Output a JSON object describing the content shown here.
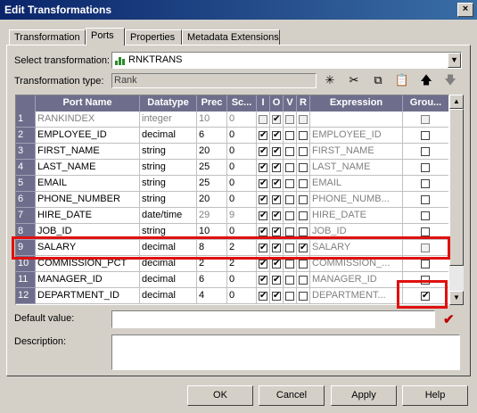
{
  "window": {
    "title": "Edit Transformations",
    "close_glyph": "×"
  },
  "tabs": [
    "Transformation",
    "Ports",
    "Properties",
    "Metadata Extensions"
  ],
  "select_transformation": {
    "label": "Select transformation:",
    "value": "RNKTRANS",
    "icon": "rank-transformation-icon"
  },
  "transformation_type": {
    "label": "Transformation type:",
    "value": "Rank"
  },
  "toolbar": {
    "new_icon": "✳",
    "cut_icon": "✂",
    "copy_icon": "⧉",
    "paste_icon": "📋",
    "up_icon": "🡅",
    "down_icon": "🡇"
  },
  "columns": [
    "Port Name",
    "Datatype",
    "Prec",
    "Sc...",
    "I",
    "O",
    "V",
    "R",
    "Expression",
    "Grou..."
  ],
  "rows": [
    {
      "n": "1",
      "name": "RANKINDEX",
      "type": "integer",
      "prec": "10",
      "scale": "0",
      "I": false,
      "O": true,
      "V": false,
      "R": false,
      "expr": "",
      "group": false,
      "dim": true
    },
    {
      "n": "2",
      "name": "EMPLOYEE_ID",
      "type": "decimal",
      "prec": "6",
      "scale": "0",
      "I": true,
      "O": true,
      "V": false,
      "R": false,
      "expr": "EMPLOYEE_ID",
      "group": false
    },
    {
      "n": "3",
      "name": "FIRST_NAME",
      "type": "string",
      "prec": "20",
      "scale": "0",
      "I": true,
      "O": true,
      "V": false,
      "R": false,
      "expr": "FIRST_NAME",
      "group": false
    },
    {
      "n": "4",
      "name": "LAST_NAME",
      "type": "string",
      "prec": "25",
      "scale": "0",
      "I": true,
      "O": true,
      "V": false,
      "R": false,
      "expr": "LAST_NAME",
      "group": false
    },
    {
      "n": "5",
      "name": "EMAIL",
      "type": "string",
      "prec": "25",
      "scale": "0",
      "I": true,
      "O": true,
      "V": false,
      "R": false,
      "expr": "EMAIL",
      "group": false
    },
    {
      "n": "6",
      "name": "PHONE_NUMBER",
      "type": "string",
      "prec": "20",
      "scale": "0",
      "I": true,
      "O": true,
      "V": false,
      "R": false,
      "expr": "PHONE_NUMB...",
      "group": false
    },
    {
      "n": "7",
      "name": "HIRE_DATE",
      "type": "date/time",
      "prec": "29",
      "scale": "9",
      "I": true,
      "O": true,
      "V": false,
      "R": false,
      "expr": "HIRE_DATE",
      "group": false
    },
    {
      "n": "8",
      "name": "JOB_ID",
      "type": "string",
      "prec": "10",
      "scale": "0",
      "I": true,
      "O": true,
      "V": false,
      "R": false,
      "expr": "JOB_ID",
      "group": false
    },
    {
      "n": "9",
      "name": "SALARY",
      "type": "decimal",
      "prec": "8",
      "scale": "2",
      "I": true,
      "O": true,
      "V": false,
      "R": true,
      "expr": "SALARY",
      "group": false
    },
    {
      "n": "10",
      "name": "COMMISSION_PCT",
      "type": "decimal",
      "prec": "2",
      "scale": "2",
      "I": true,
      "O": true,
      "V": false,
      "R": false,
      "expr": "COMMISSION_...",
      "group": false
    },
    {
      "n": "11",
      "name": "MANAGER_ID",
      "type": "decimal",
      "prec": "6",
      "scale": "0",
      "I": true,
      "O": true,
      "V": false,
      "R": false,
      "expr": "MANAGER_ID",
      "group": false
    },
    {
      "n": "12",
      "name": "DEPARTMENT_ID",
      "type": "decimal",
      "prec": "4",
      "scale": "0",
      "I": true,
      "O": true,
      "V": false,
      "R": false,
      "expr": "DEPARTMENT...",
      "group": true
    }
  ],
  "default_value": {
    "label": "Default value:",
    "value": "",
    "validate_icon": "✔"
  },
  "description": {
    "label": "Description:",
    "value": ""
  },
  "buttons": {
    "ok": "OK",
    "cancel": "Cancel",
    "apply": "Apply",
    "help": "Help"
  },
  "highlight_color": "#e01010",
  "header_color": "#6e6e8c"
}
